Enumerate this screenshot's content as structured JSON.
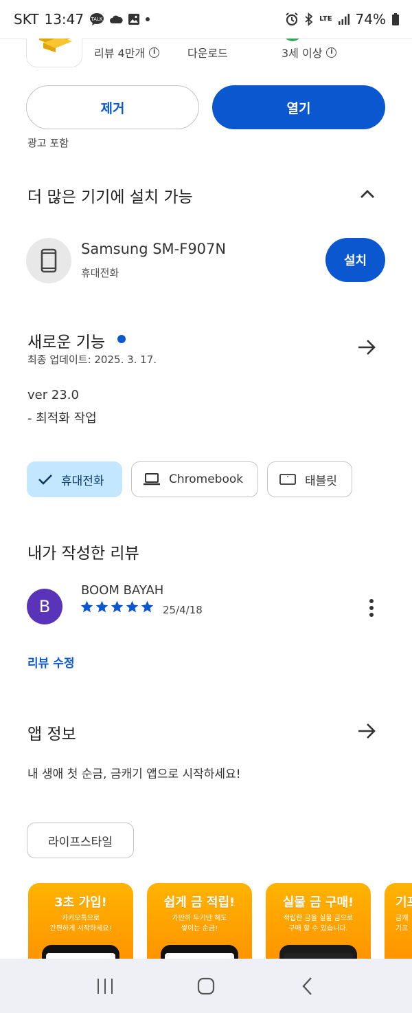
{
  "status_bar": {
    "carrier": "SKT",
    "time": "13:47",
    "notifications": [
      "talk-icon",
      "cloud-icon",
      "image-icon",
      "dot"
    ],
    "lte_label": "LTE",
    "battery": "74%"
  },
  "app_header": {
    "reviews": "리뷰 4만개",
    "downloads": "다운로드",
    "age_rating": "3세 이상"
  },
  "actions": {
    "remove_label": "제거",
    "open_label": "열기",
    "ads_note": "광고 포함"
  },
  "more_devices": {
    "title": "더 많은 기기에 설치 가능",
    "device_name": "Samsung SM-F907N",
    "device_type": "휴대전화",
    "install_label": "설치"
  },
  "whats_new": {
    "title": "새로운 기능",
    "updated": "최종 업데이트: 2025. 3. 17.",
    "lines": [
      "ver 23.0",
      "- 최적화 작업"
    ]
  },
  "device_chips": [
    {
      "label": "휴대전화",
      "selected": true
    },
    {
      "label": "Chromebook",
      "selected": false
    },
    {
      "label": "태블릿",
      "selected": false
    }
  ],
  "my_review": {
    "title": "내가 작성한 리뷰",
    "avatar_letter": "B",
    "reviewer": "BOOM BAYAH",
    "rating": 5,
    "date": "25/4/18",
    "edit_label": "리뷰 수정"
  },
  "app_info": {
    "title": "앱 정보",
    "description": "내 생애 첫 순금, 금캐기 앱으로 시작하세요!",
    "category": "라이프스타일"
  },
  "screenshots": [
    {
      "headline": "3초 가입!",
      "sub1": "카카오톡으로",
      "sub2": "간편하게 시작하세요!"
    },
    {
      "headline": "쉽게 금 적립!",
      "sub1": "가만히 두기만 해도",
      "sub2": "쌓이는 순금!"
    },
    {
      "headline": "실물 금 구매!",
      "sub1": "적립한 금을 실물 금으로",
      "sub2": "구매 할 수 있습니다."
    },
    {
      "headline": "기프",
      "sub1": "금캐",
      "sub2": "기프"
    }
  ],
  "colors": {
    "accent": "#0b57d0",
    "chip_selected": "#c2e7ff",
    "avatar": "#5a34b8",
    "screenshot_bg": "#ffa000"
  }
}
